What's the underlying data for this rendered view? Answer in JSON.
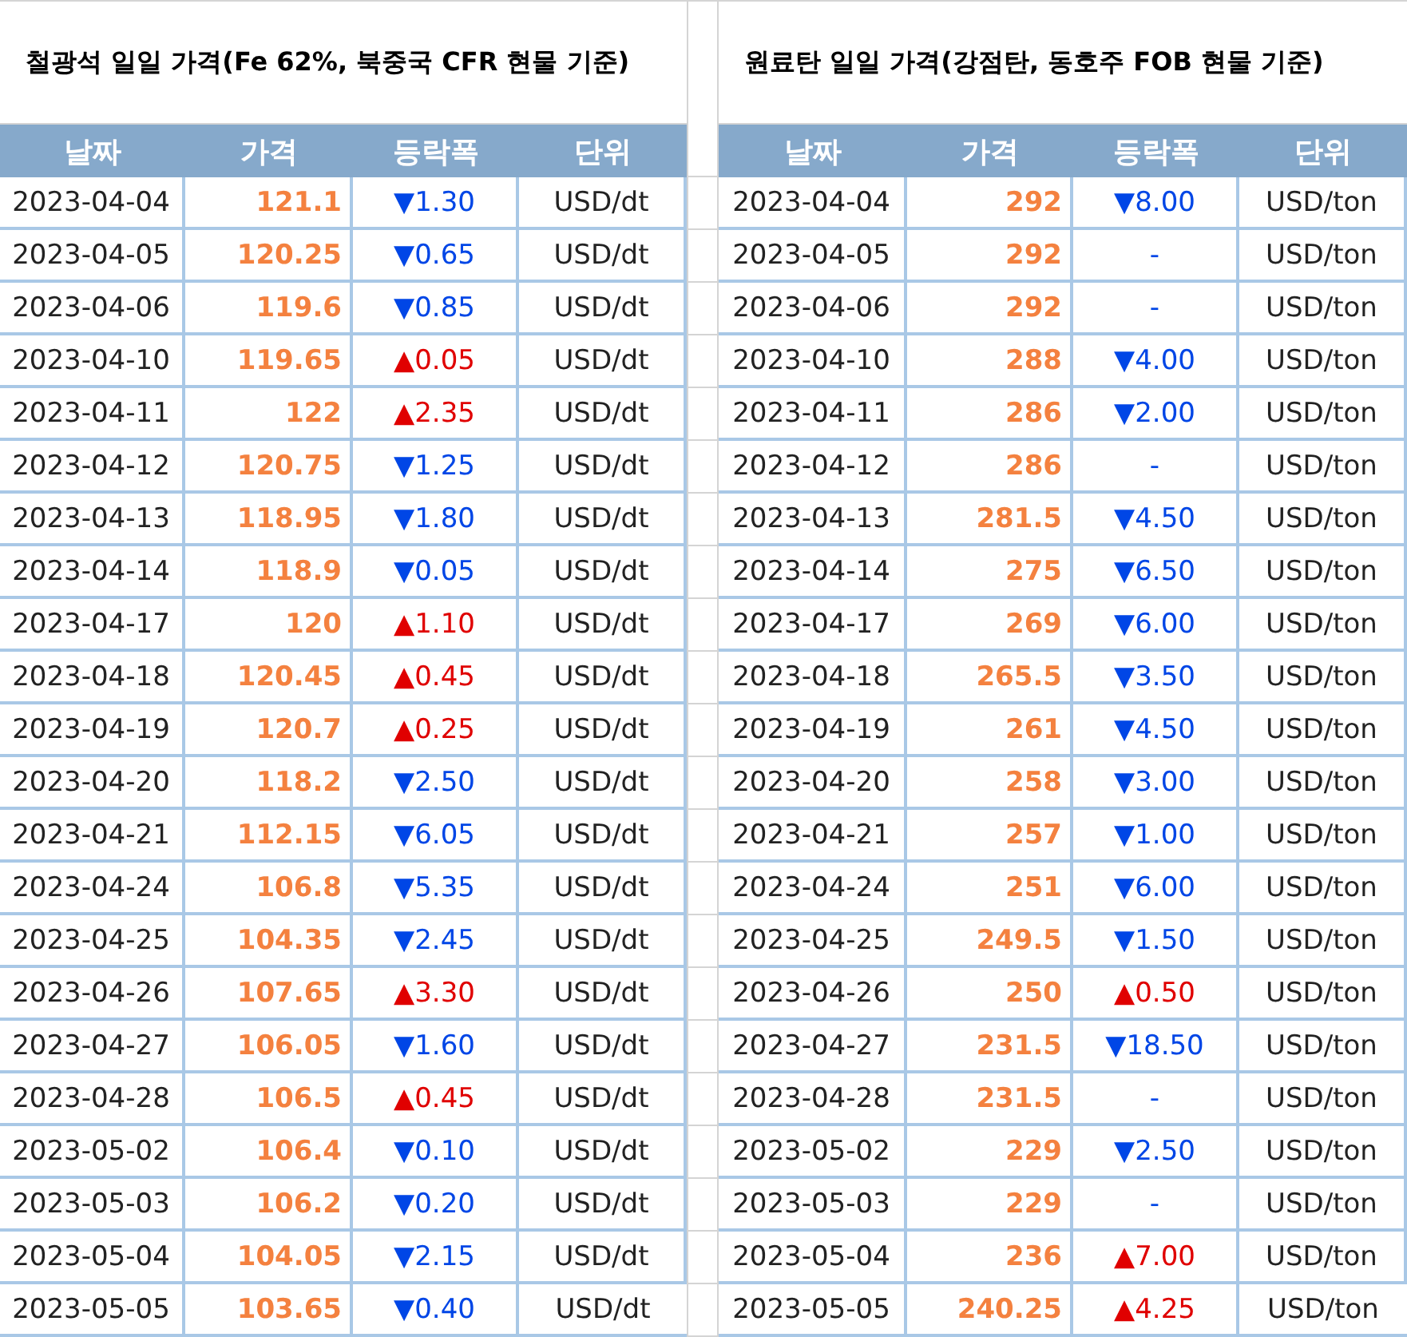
{
  "tables": [
    {
      "title": "철광석 일일 가격(Fe 62%, 북중국 CFR 현물 기준)",
      "columns": [
        "날짜",
        "가격",
        "등락폭",
        "단위"
      ],
      "rows": [
        {
          "date": "2023-04-04",
          "price": "121.1",
          "change": "▼1.30",
          "kind": "down",
          "unit": "USD/dt"
        },
        {
          "date": "2023-04-05",
          "price": "120.25",
          "change": "▼0.65",
          "kind": "down",
          "unit": "USD/dt"
        },
        {
          "date": "2023-04-06",
          "price": "119.6",
          "change": "▼0.85",
          "kind": "down",
          "unit": "USD/dt"
        },
        {
          "date": "2023-04-10",
          "price": "119.65",
          "change": "▲0.05",
          "kind": "up",
          "unit": "USD/dt"
        },
        {
          "date": "2023-04-11",
          "price": "122",
          "change": "▲2.35",
          "kind": "up",
          "unit": "USD/dt"
        },
        {
          "date": "2023-04-12",
          "price": "120.75",
          "change": "▼1.25",
          "kind": "down",
          "unit": "USD/dt"
        },
        {
          "date": "2023-04-13",
          "price": "118.95",
          "change": "▼1.80",
          "kind": "down",
          "unit": "USD/dt"
        },
        {
          "date": "2023-04-14",
          "price": "118.9",
          "change": "▼0.05",
          "kind": "down",
          "unit": "USD/dt"
        },
        {
          "date": "2023-04-17",
          "price": "120",
          "change": "▲1.10",
          "kind": "up",
          "unit": "USD/dt"
        },
        {
          "date": "2023-04-18",
          "price": "120.45",
          "change": "▲0.45",
          "kind": "up",
          "unit": "USD/dt"
        },
        {
          "date": "2023-04-19",
          "price": "120.7",
          "change": "▲0.25",
          "kind": "up",
          "unit": "USD/dt"
        },
        {
          "date": "2023-04-20",
          "price": "118.2",
          "change": "▼2.50",
          "kind": "down",
          "unit": "USD/dt"
        },
        {
          "date": "2023-04-21",
          "price": "112.15",
          "change": "▼6.05",
          "kind": "down",
          "unit": "USD/dt"
        },
        {
          "date": "2023-04-24",
          "price": "106.8",
          "change": "▼5.35",
          "kind": "down",
          "unit": "USD/dt"
        },
        {
          "date": "2023-04-25",
          "price": "104.35",
          "change": "▼2.45",
          "kind": "down",
          "unit": "USD/dt"
        },
        {
          "date": "2023-04-26",
          "price": "107.65",
          "change": "▲3.30",
          "kind": "up",
          "unit": "USD/dt"
        },
        {
          "date": "2023-04-27",
          "price": "106.05",
          "change": "▼1.60",
          "kind": "down",
          "unit": "USD/dt"
        },
        {
          "date": "2023-04-28",
          "price": "106.5",
          "change": "▲0.45",
          "kind": "up",
          "unit": "USD/dt"
        },
        {
          "date": "2023-05-02",
          "price": "106.4",
          "change": "▼0.10",
          "kind": "down",
          "unit": "USD/dt"
        },
        {
          "date": "2023-05-03",
          "price": "106.2",
          "change": "▼0.20",
          "kind": "down",
          "unit": "USD/dt"
        },
        {
          "date": "2023-05-04",
          "price": "104.05",
          "change": "▼2.15",
          "kind": "down",
          "unit": "USD/dt"
        },
        {
          "date": "2023-05-05",
          "price": "103.65",
          "change": "▼0.40",
          "kind": "down",
          "unit": "USD/dt"
        }
      ]
    },
    {
      "title": "원료탄 일일 가격(강점탄, 동호주 FOB 현물 기준)",
      "columns": [
        "날짜",
        "가격",
        "등락폭",
        "단위"
      ],
      "rows": [
        {
          "date": "2023-04-04",
          "price": "292",
          "change": "▼8.00",
          "kind": "down",
          "unit": "USD/ton"
        },
        {
          "date": "2023-04-05",
          "price": "292",
          "change": "-",
          "kind": "flat",
          "unit": "USD/ton"
        },
        {
          "date": "2023-04-06",
          "price": "292",
          "change": "-",
          "kind": "flat",
          "unit": "USD/ton"
        },
        {
          "date": "2023-04-10",
          "price": "288",
          "change": "▼4.00",
          "kind": "down",
          "unit": "USD/ton"
        },
        {
          "date": "2023-04-11",
          "price": "286",
          "change": "▼2.00",
          "kind": "down",
          "unit": "USD/ton"
        },
        {
          "date": "2023-04-12",
          "price": "286",
          "change": "-",
          "kind": "flat",
          "unit": "USD/ton"
        },
        {
          "date": "2023-04-13",
          "price": "281.5",
          "change": "▼4.50",
          "kind": "down",
          "unit": "USD/ton"
        },
        {
          "date": "2023-04-14",
          "price": "275",
          "change": "▼6.50",
          "kind": "down",
          "unit": "USD/ton"
        },
        {
          "date": "2023-04-17",
          "price": "269",
          "change": "▼6.00",
          "kind": "down",
          "unit": "USD/ton"
        },
        {
          "date": "2023-04-18",
          "price": "265.5",
          "change": "▼3.50",
          "kind": "down",
          "unit": "USD/ton"
        },
        {
          "date": "2023-04-19",
          "price": "261",
          "change": "▼4.50",
          "kind": "down",
          "unit": "USD/ton"
        },
        {
          "date": "2023-04-20",
          "price": "258",
          "change": "▼3.00",
          "kind": "down",
          "unit": "USD/ton"
        },
        {
          "date": "2023-04-21",
          "price": "257",
          "change": "▼1.00",
          "kind": "down",
          "unit": "USD/ton"
        },
        {
          "date": "2023-04-24",
          "price": "251",
          "change": "▼6.00",
          "kind": "down",
          "unit": "USD/ton"
        },
        {
          "date": "2023-04-25",
          "price": "249.5",
          "change": "▼1.50",
          "kind": "down",
          "unit": "USD/ton"
        },
        {
          "date": "2023-04-26",
          "price": "250",
          "change": "▲0.50",
          "kind": "up",
          "unit": "USD/ton"
        },
        {
          "date": "2023-04-27",
          "price": "231.5",
          "change": "▼18.50",
          "kind": "down",
          "unit": "USD/ton"
        },
        {
          "date": "2023-04-28",
          "price": "231.5",
          "change": "-",
          "kind": "flat",
          "unit": "USD/ton"
        },
        {
          "date": "2023-05-02",
          "price": "229",
          "change": "▼2.50",
          "kind": "down",
          "unit": "USD/ton"
        },
        {
          "date": "2023-05-03",
          "price": "229",
          "change": "-",
          "kind": "flat",
          "unit": "USD/ton"
        },
        {
          "date": "2023-05-04",
          "price": "236",
          "change": "▲7.00",
          "kind": "up",
          "unit": "USD/ton"
        },
        {
          "date": "2023-05-05",
          "price": "240.25",
          "change": "▲4.25",
          "kind": "up",
          "unit": "USD/ton"
        }
      ]
    }
  ]
}
